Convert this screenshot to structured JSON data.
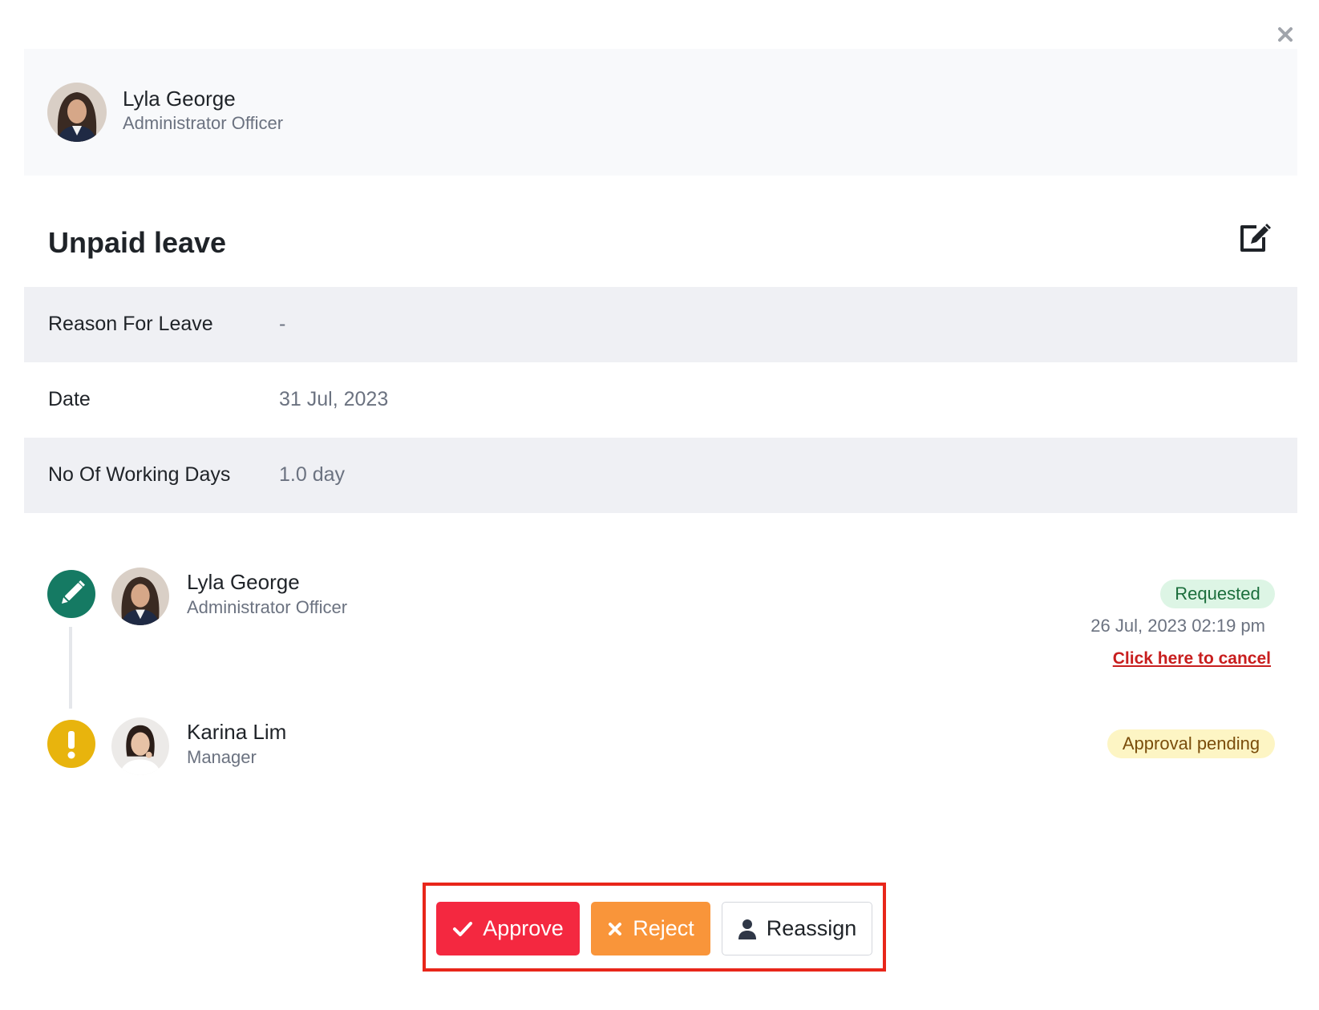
{
  "requester": {
    "name": "Lyla George",
    "role": "Administrator Officer"
  },
  "leave": {
    "title": "Unpaid leave",
    "details": [
      {
        "label": "Reason For Leave",
        "value": "-"
      },
      {
        "label": "Date",
        "value": "31 Jul, 2023"
      },
      {
        "label": "No Of Working Days",
        "value": "1.0 day"
      }
    ]
  },
  "timeline": [
    {
      "name": "Lyla George",
      "role": "Administrator Officer",
      "status": "Requested",
      "status_icon": "pencil-icon",
      "timestamp": "26 Jul, 2023 02:19 pm",
      "action_link": "Click here to cancel"
    },
    {
      "name": "Karina Lim",
      "role": "Manager",
      "status": "Approval pending",
      "status_icon": "exclamation-icon"
    }
  ],
  "actions": {
    "approve": "Approve",
    "reject": "Reject",
    "reassign": "Reassign"
  },
  "colors": {
    "approve": "#f42840",
    "reject": "#f9953a",
    "requested_icon": "#157a63",
    "pending_icon": "#e8b40d",
    "highlight_frame": "#e8261a"
  }
}
